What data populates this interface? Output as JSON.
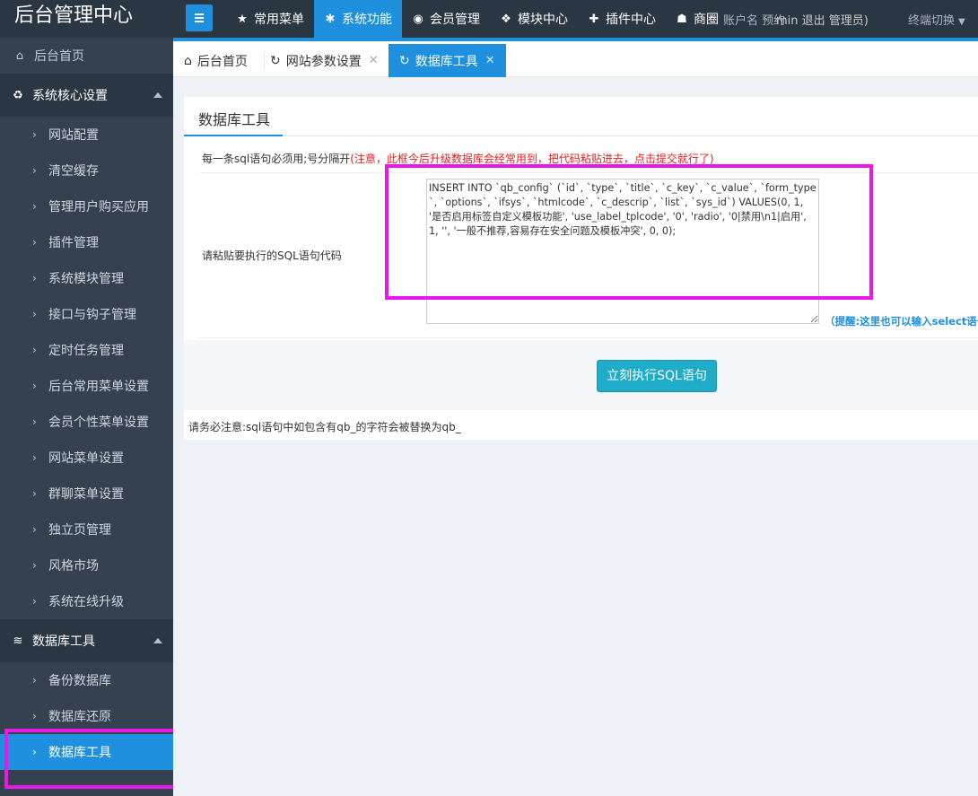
{
  "brand": "后台管理中心",
  "topnav": [
    {
      "icon": "star-icon",
      "glyph": "★",
      "label": "常用菜单"
    },
    {
      "icon": "gear-icon",
      "glyph": "✱",
      "label": "系统功能",
      "active": true
    },
    {
      "icon": "user-circle-icon",
      "glyph": "◉",
      "label": "会员管理"
    },
    {
      "icon": "cubes-icon",
      "glyph": "❖",
      "label": "模块中心"
    },
    {
      "icon": "puzzle-icon",
      "glyph": "✚",
      "label": "插件中心"
    },
    {
      "icon": "users-icon",
      "glyph": "☗",
      "label": "商圈"
    }
  ],
  "overlap_text_a": "账户名 预约",
  "overlap_text_b": "min 退出 管理员)",
  "terminal_switch": "终端切换",
  "sidebar": {
    "home": "后台首页",
    "group1": {
      "label": "系统核心设置",
      "icon_glyph": "♻"
    },
    "group1_items": [
      "网站配置",
      "清空缓存",
      "管理用户购买应用",
      "插件管理",
      "系统模块管理",
      "接口与钩子管理",
      "定时任务管理",
      "后台常用菜单设置",
      "会员个性菜单设置",
      "网站菜单设置",
      "群聊菜单设置",
      "独立页管理",
      "风格市场",
      "系统在线升级"
    ],
    "group2": {
      "label": "数据库工具",
      "icon_glyph": "≋"
    },
    "group2_items": [
      "备份数据库",
      "数据库还原",
      "数据库工具"
    ]
  },
  "tabs": [
    {
      "label": "后台首页",
      "glyph": "⌂"
    },
    {
      "label": "网站参数设置",
      "glyph": "↻"
    },
    {
      "label": "数据库工具",
      "glyph": "↻"
    }
  ],
  "tab_close": "✕",
  "panel_title": "数据库工具",
  "note": {
    "prefix": "每一条sql语句必须用;号分隔开",
    "red": "(注意，此框今后升级数据库会经常用到，把代码粘贴进去，点击提交就行了)"
  },
  "sql_label": "请粘贴要执行的SQL语句代码",
  "sql_value": "INSERT INTO `qb_config` (`id`, `type`, `title`, `c_key`, `c_value`, `form_type`, `options`, `ifsys`, `htmlcode`, `c_descrip`, `list`, `sys_id`) VALUES(0, 1, '是否启用标签自定义模板功能', 'use_label_tplcode', '0', 'radio', '0|禁用\\n1|启用', 1, '', '一般不推荐,容易存在安全问题及模板冲突', 0, 0);",
  "hint": "（提醒:这里也可以输入select语句",
  "exec_button": "立刻执行SQL语句",
  "notice": "请务必注意:sql语句中如包含有qb_的字符会被替换为qb_",
  "colors": {
    "accent": "#1e90dd",
    "highlight": "#e619e6",
    "button": "#1eacc8"
  }
}
